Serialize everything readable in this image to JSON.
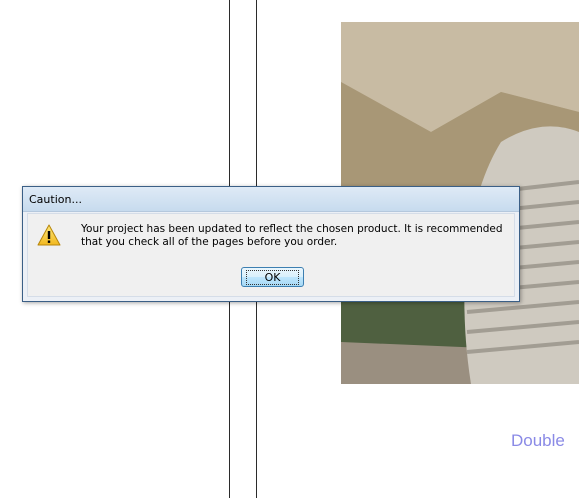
{
  "dialog": {
    "title": "Caution...",
    "message_line1": "Your project has been updated to reflect the chosen product. It is recommended",
    "message_line2": "that you check all of the pages before you order.",
    "ok_label": "OK",
    "icon": "warning-icon"
  },
  "canvas": {
    "caption_text": "Double"
  },
  "colors": {
    "caption": "#8a8ae6",
    "dialog_border": "#3b5f86",
    "button_border": "#3c7fb1"
  }
}
